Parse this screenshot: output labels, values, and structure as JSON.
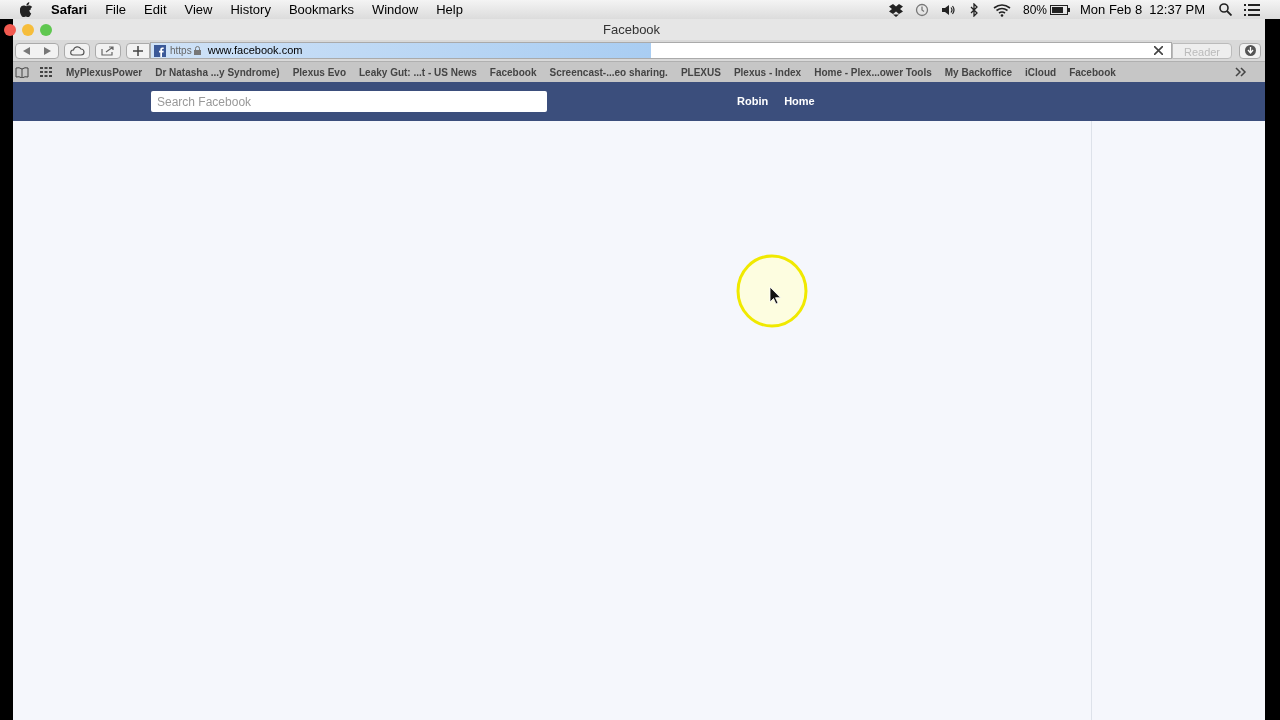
{
  "menu_bar": {
    "app": "Safari",
    "items": [
      "File",
      "Edit",
      "View",
      "History",
      "Bookmarks",
      "Window",
      "Help"
    ],
    "battery": "80%",
    "clock": "Mon Feb 8  12:37 PM"
  },
  "window": {
    "title": "Facebook"
  },
  "toolbar": {
    "scheme": "https",
    "url": "www.facebook.com",
    "load_progress": {
      "level": 0.49
    },
    "reader": "Reader"
  },
  "bookmarks": [
    "MyPlexusPower",
    "Dr Natasha ...y Syndrome)",
    "Plexus Evo",
    "Leaky Gut: ...t - US News",
    "Facebook",
    "Screencast-...eo sharing.",
    "PLEXUS",
    "Plexus - Index",
    "Home - Plex...ower Tools",
    "My Backoffice",
    "iCloud",
    "Facebook"
  ],
  "facebook_header": {
    "search": {
      "placeholder": "Search Facebook"
    },
    "nav": [
      "Robin",
      "Home"
    ]
  }
}
